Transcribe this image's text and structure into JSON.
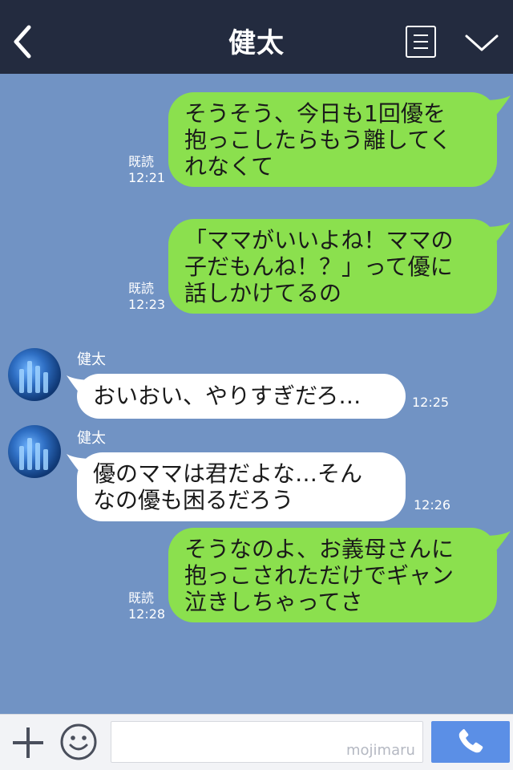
{
  "header": {
    "title": "健太"
  },
  "chat": {
    "messages": [
      {
        "direction": "out",
        "text": "そうそう、今日も1回優を\n抱っこしたらもう離してく\nれなくて",
        "read": "既読",
        "time": "12:21"
      },
      {
        "direction": "out",
        "text": "「ママがいいよね！ママの\n子だもんね！？」って優に\n話しかけてるの",
        "read": "既読",
        "time": "12:23"
      },
      {
        "direction": "in",
        "sender": "健太",
        "text": "おいおい、やりすぎだろ…",
        "time": "12:25"
      },
      {
        "direction": "in",
        "sender": "健太",
        "text": "優のママは君だよな…そん\nなの優も困るだろう",
        "time": "12:26"
      },
      {
        "direction": "out",
        "text": "そうなのよ、お義母さんに\n抱っこされただけでギャン\n泣きしちゃってさ",
        "read": "既読",
        "time": "12:28"
      }
    ]
  },
  "input": {
    "value": "",
    "watermark": "mojimaru"
  },
  "colors": {
    "header_bg": "#232b3f",
    "chat_bg": "#7193c4",
    "outgoing_bubble": "#8be04e",
    "incoming_bubble": "#ffffff",
    "call_button": "#5b8fe6"
  },
  "icons": {
    "back": "chevron-left-icon",
    "menu": "menu-lines-icon",
    "collapse": "chevron-down-icon",
    "plus": "plus-icon",
    "emoji": "smiley-icon",
    "call": "phone-icon"
  }
}
